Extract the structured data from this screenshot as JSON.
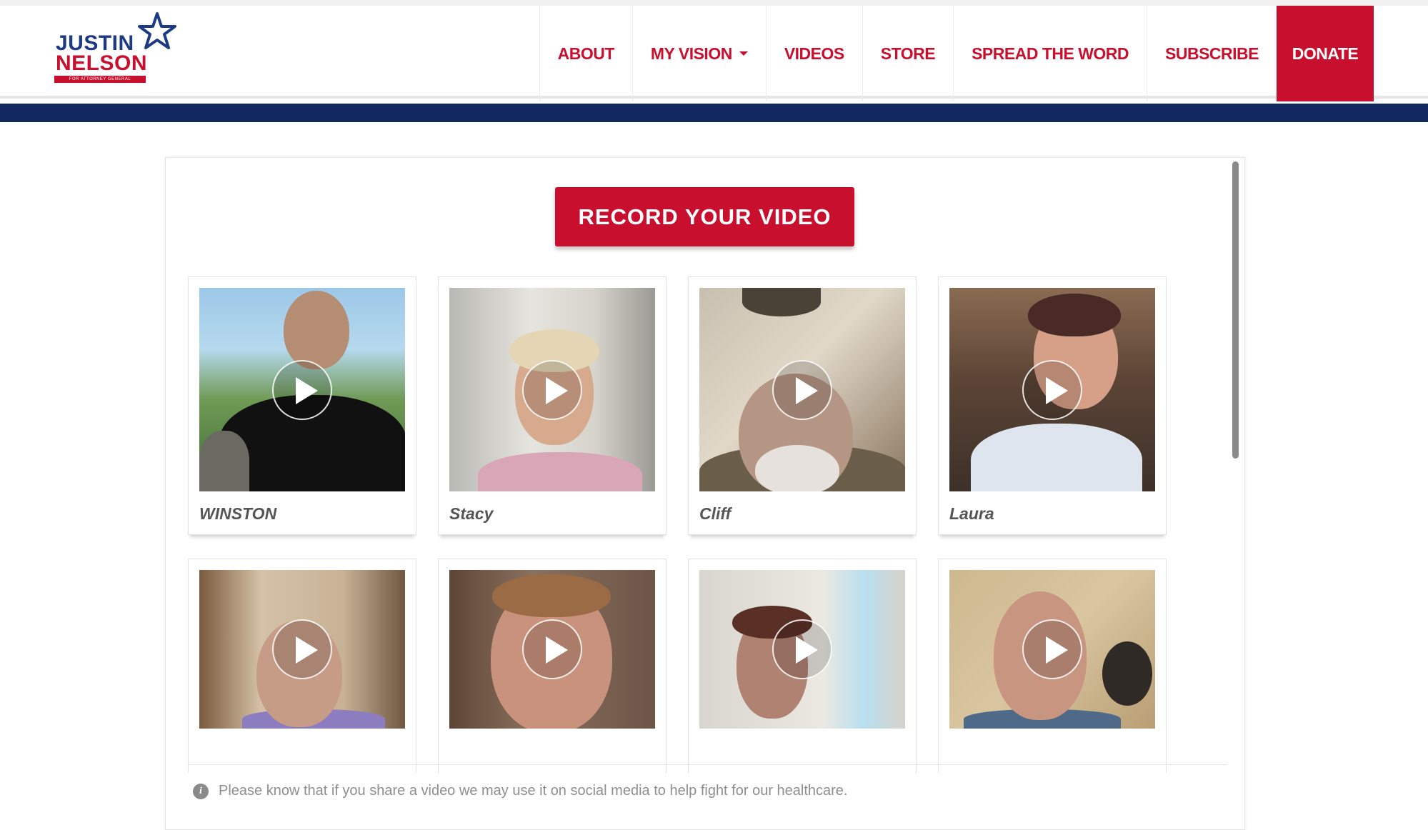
{
  "logo": {
    "line1": "JUSTIN",
    "line2": "NELSON",
    "tagline": "FOR ATTORNEY GENERAL",
    "icon": "star-icon"
  },
  "nav": {
    "items": [
      {
        "label": "ABOUT"
      },
      {
        "label": "MY VISION",
        "icon": "caret-down-icon"
      },
      {
        "label": "VIDEOS"
      },
      {
        "label": "STORE"
      },
      {
        "label": "SPREAD THE WORD"
      },
      {
        "label": "SUBSCRIBE"
      },
      {
        "label": "DONATE"
      }
    ]
  },
  "main": {
    "record_button": "RECORD YOUR VIDEO",
    "videos": [
      {
        "name": "WINSTON"
      },
      {
        "name": "Stacy"
      },
      {
        "name": "Cliff"
      },
      {
        "name": "Laura"
      },
      {
        "name": ""
      },
      {
        "name": ""
      },
      {
        "name": ""
      },
      {
        "name": ""
      }
    ],
    "notice": "Please know that if you share a video we may use it on social media to help fight for our healthcare.",
    "notice_icon": "info-icon"
  },
  "colors": {
    "brand_red": "#c8102e",
    "navy": "#11285e",
    "text_gray": "#8e8e8e"
  }
}
